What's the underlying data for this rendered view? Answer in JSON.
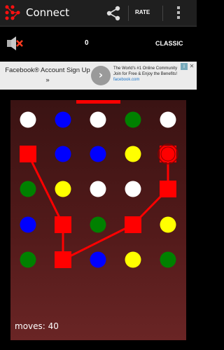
{
  "app": {
    "title": "Connect",
    "rate_label": "RATE",
    "icons": [
      "app-dots-icon",
      "share-icon",
      "overflow-menu-icon"
    ]
  },
  "status": {
    "score": "0",
    "mode": "CLASSIC",
    "sound_icon": "speaker-muted-icon"
  },
  "ad": {
    "left_text": "Facebook® Account Sign Up »",
    "right_line1": "The World's #1 Online Community",
    "right_line2": "Join for Free & Enjoy the Benefits!",
    "right_url": "facebook.com",
    "arrow": "›",
    "info": "i",
    "close": "✕"
  },
  "game": {
    "moves_label": "moves: 40",
    "moves": 40,
    "colors": {
      "white": "#ffffff",
      "blue": "#0000ff",
      "green": "#008000",
      "yellow": "#ffff00",
      "red": "#ff0000"
    },
    "rows": [
      [
        "white",
        "blue",
        "white",
        "green",
        "white"
      ],
      [
        "red",
        "blue",
        "blue",
        "yellow",
        "red"
      ],
      [
        "green",
        "yellow",
        "white",
        "white",
        "red"
      ],
      [
        "blue",
        "red",
        "green",
        "red",
        "yellow"
      ],
      [
        "green",
        "red",
        "blue",
        "yellow",
        "green"
      ]
    ],
    "selected_path": [
      [
        1,
        0
      ],
      [
        3,
        1
      ],
      [
        4,
        1
      ],
      [
        3,
        3
      ],
      [
        2,
        4
      ],
      [
        1,
        4
      ]
    ],
    "active_cell": [
      1,
      4
    ]
  }
}
